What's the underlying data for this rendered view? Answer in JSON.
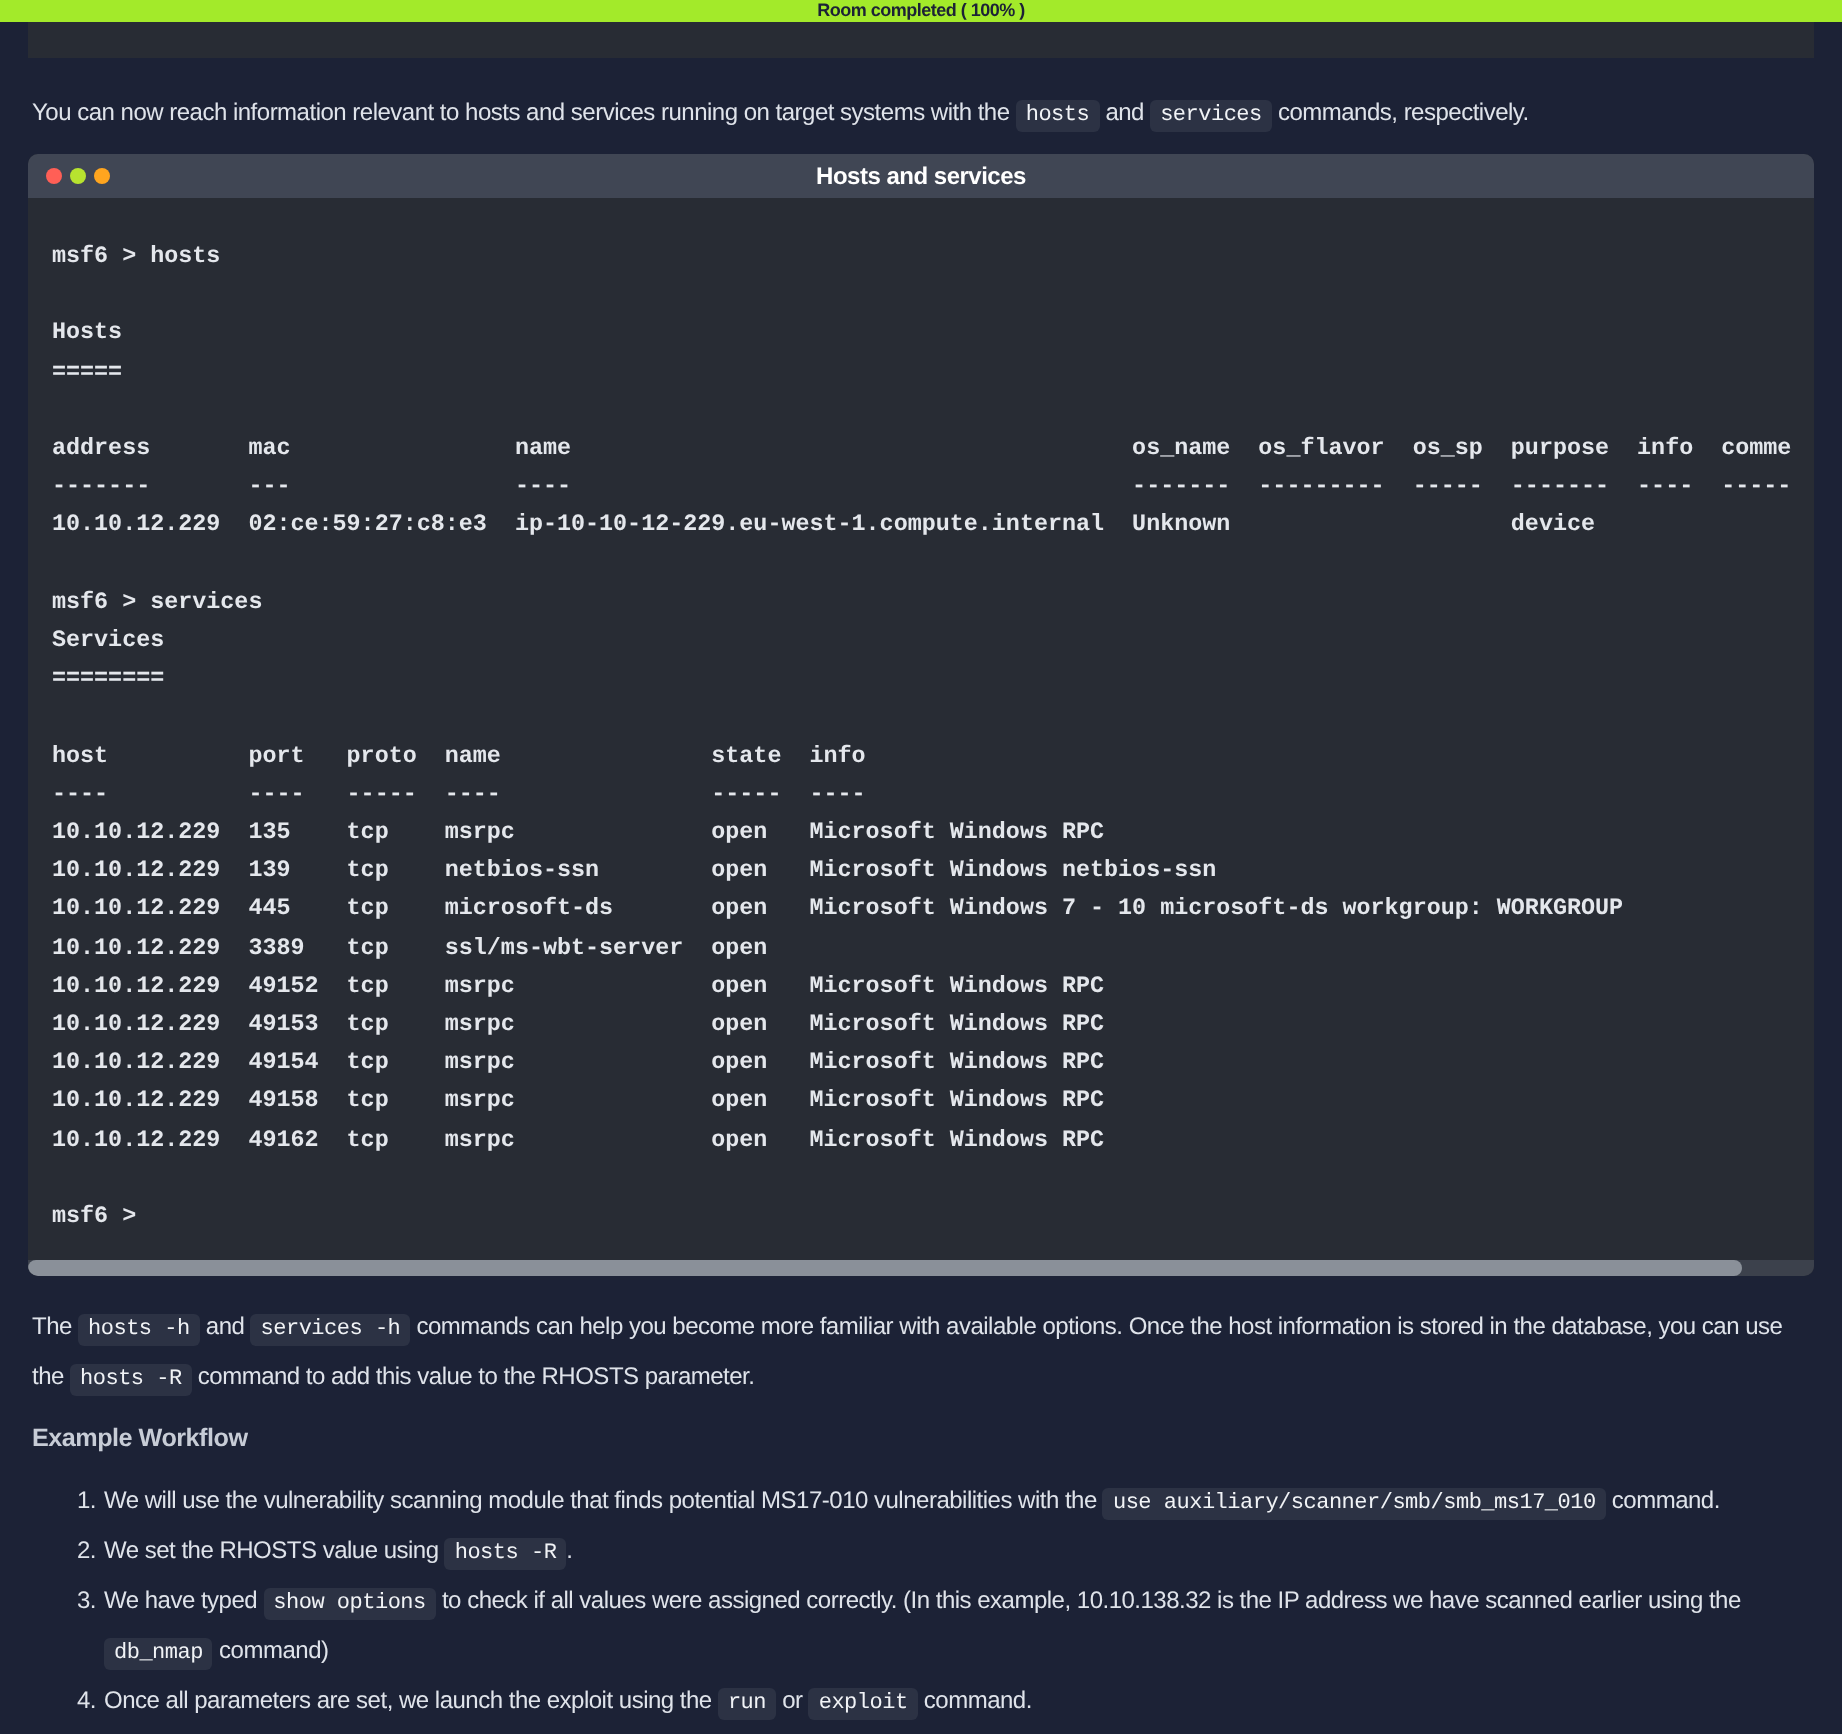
{
  "banner": {
    "text": "Room completed ( 100% )"
  },
  "intro": [
    {
      "text": "You can now reach information relevant to hosts and services running on target systems with the ",
      "code": false
    },
    {
      "text": "hosts",
      "code": true
    },
    {
      "text": " and ",
      "code": false
    },
    {
      "text": "services",
      "code": true
    },
    {
      "text": " commands, respectively.",
      "code": false
    }
  ],
  "terminal": {
    "title": "Hosts and services",
    "blocks": [
      [
        "msf6 > hosts"
      ],
      [
        "Hosts",
        "====="
      ],
      [
        "address       mac                name                                        os_name  os_flavor  os_sp  purpose  info  comme",
        "-------       ---                ----                                        -------  ---------  -----  -------  ----  -----",
        "10.10.12.229  02:ce:59:27:c8:e3  ip-10-10-12-229.eu-west-1.compute.internal  Unknown                    device"
      ],
      [
        "msf6 > services",
        "Services",
        "========"
      ],
      [
        "host          port   proto  name               state  info",
        "----          ----   -----  ----               -----  ----",
        "10.10.12.229  135    tcp    msrpc              open   Microsoft Windows RPC",
        "10.10.12.229  139    tcp    netbios-ssn        open   Microsoft Windows netbios-ssn",
        "10.10.12.229  445    tcp    microsoft-ds       open   Microsoft Windows 7 - 10 microsoft-ds workgroup: WORKGROUP",
        "10.10.12.229  3389   tcp    ssl/ms-wbt-server  open",
        "10.10.12.229  49152  tcp    msrpc              open   Microsoft Windows RPC",
        "10.10.12.229  49153  tcp    msrpc              open   Microsoft Windows RPC",
        "10.10.12.229  49154  tcp    msrpc              open   Microsoft Windows RPC",
        "10.10.12.229  49158  tcp    msrpc              open   Microsoft Windows RPC",
        "10.10.12.229  49162  tcp    msrpc              open   Microsoft Windows RPC"
      ],
      [
        "msf6 >"
      ]
    ]
  },
  "help": [
    {
      "text": "The ",
      "code": false
    },
    {
      "text": "hosts -h",
      "code": true
    },
    {
      "text": " and ",
      "code": false
    },
    {
      "text": "services -h",
      "code": true
    },
    {
      "text": " commands can help you become more familiar with available options. Once the host information is stored in the database, you can use the ",
      "code": false
    },
    {
      "text": "hosts -R",
      "code": true
    },
    {
      "text": " command to add this value to the RHOSTS parameter.",
      "code": false
    }
  ],
  "heading": "Example Workflow",
  "steps": [
    {
      "number": "1.",
      "parts": [
        {
          "text": "We will use the vulnerability scanning module that finds potential MS17-010 vulnerabilities with the ",
          "code": false
        },
        {
          "text": "use auxiliary/scanner/smb/smb_ms17_010",
          "code": true
        },
        {
          "text": " command.",
          "code": false
        }
      ]
    },
    {
      "number": "2.",
      "parts": [
        {
          "text": "We set the RHOSTS value using ",
          "code": false
        },
        {
          "text": "hosts -R",
          "code": true
        },
        {
          "text": ".",
          "code": false
        }
      ]
    },
    {
      "number": "3.",
      "parts": [
        {
          "text": "We have typed ",
          "code": false
        },
        {
          "text": "show options",
          "code": true
        },
        {
          "text": " to check if all values were assigned correctly. (In this example, 10.10.138.32 is the IP address we have scanned earlier using the ",
          "code": false
        },
        {
          "text": "db_nmap",
          "code": true
        },
        {
          "text": " command)",
          "code": false
        }
      ]
    },
    {
      "number": "4.",
      "parts": [
        {
          "text": "Once all parameters are set, we launch the exploit using the ",
          "code": false
        },
        {
          "text": "run",
          "code": true
        },
        {
          "text": " or ",
          "code": false
        },
        {
          "text": "exploit",
          "code": true
        },
        {
          "text": " command.",
          "code": false
        }
      ]
    }
  ]
}
